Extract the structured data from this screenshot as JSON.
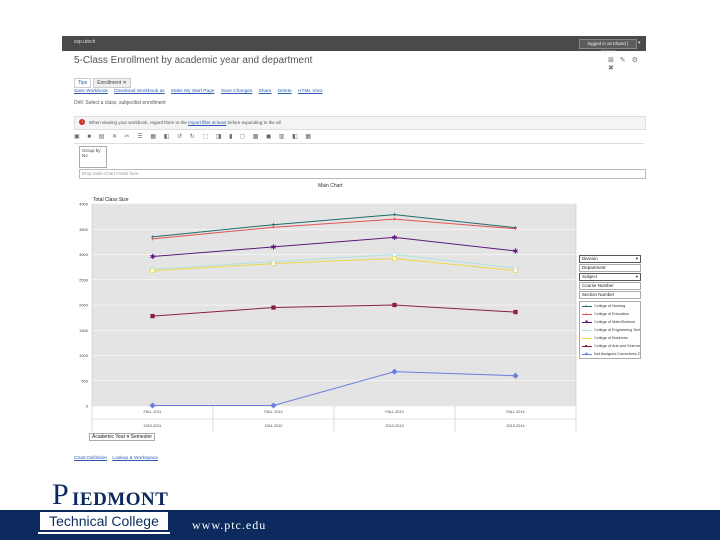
{
  "window": {
    "app_name": "ssp.utech",
    "logged_in": "logged in as bfoard | signout"
  },
  "page": {
    "title": "5-Class Enrollment by academic year and department",
    "title_icons": "⊠ ✎ ⚙ ✖"
  },
  "tabs": [
    {
      "label": "Tips"
    },
    {
      "label": "Enrollment ✕"
    }
  ],
  "links": [
    "Save Workbook",
    "Download Workbook as",
    "Make My Start Page",
    "Save Changes",
    "Share",
    "Delete",
    "HTML View"
  ],
  "drill_text": "Drill: Select a class, subjectlist enrollment",
  "warning": {
    "text_before": "When viewing your workbook, regard them to the",
    "link": "Import filter at least",
    "text_after": "before expanding to the all"
  },
  "toolbar": {
    "icons": "▣ ■ ▤ ✕ ✂ ☰ ▦ ◧ ↺ ↻ ⬚ ◨ ▮ ◻ ▩ ◼ ▥ ◧ ▦"
  },
  "group_box": {
    "line1": "Group by",
    "line2": "No"
  },
  "filter_placeholder": "Drop Multi-Chart Fields here",
  "legend": {
    "fields": [
      {
        "label": "Division",
        "has_arrow": true
      },
      {
        "label": "Department",
        "has_arrow": false
      },
      {
        "label": "Subject",
        "has_arrow": true
      },
      {
        "label": "Course Number",
        "has_arrow": false
      },
      {
        "label": "Section Number",
        "has_arrow": false
      }
    ]
  },
  "x_axis_button": "Academic Year ▾ Semester",
  "bottom_links": [
    "Chart Definition",
    "Lookup & Workspace"
  ],
  "footer": {
    "logo_initial": "P",
    "logo_rest": "IEDMONT",
    "logo_line2": "Technical College",
    "url": "www.ptc.edu"
  },
  "chart_data": {
    "type": "line",
    "title": "Main Chart",
    "ylabel": "Total Class Size",
    "categories": [
      "2010-2011",
      "2011-2012",
      "2012-2013",
      "2013-2014"
    ],
    "category_codes": [
      "FALL 2011",
      "FALL 2012",
      "FALL 2013",
      "FALL 2014"
    ],
    "ylim": [
      0,
      4000
    ],
    "y_ticks": [
      "0",
      "500",
      "1000",
      "1500",
      "2000",
      "2500",
      "3000",
      "3500",
      "4000"
    ],
    "series": [
      {
        "name": "College of Nursing",
        "color": "#1f6b6b",
        "marker": "+",
        "values": [
          3350,
          3590,
          3790,
          3530
        ]
      },
      {
        "name": "College of Education",
        "color": "#e05555",
        "marker": "+",
        "values": [
          3310,
          3540,
          3700,
          3510
        ]
      },
      {
        "name": "College of Math/Science",
        "color": "#5c1a7a",
        "marker": "✱",
        "values": [
          2960,
          3150,
          3340,
          3070
        ]
      },
      {
        "name": "College of Engineering Tech",
        "color": "#aee0e0",
        "marker": "◇",
        "values": [
          2710,
          2860,
          3000,
          2730
        ]
      },
      {
        "name": "College of Business",
        "color": "#e8d84a",
        "marker": "□",
        "values": [
          2680,
          2820,
          2920,
          2680
        ]
      },
      {
        "name": "College of Arts and Sciences",
        "color": "#8a1f4a",
        "marker": "■",
        "values": [
          1780,
          1950,
          2000,
          1860
        ]
      },
      {
        "name": "Not Assigned Corrections Div",
        "color": "#6c7de0",
        "marker": "◆",
        "values": [
          10,
          10,
          680,
          600
        ]
      }
    ],
    "grid": true,
    "legend_position": "right"
  }
}
